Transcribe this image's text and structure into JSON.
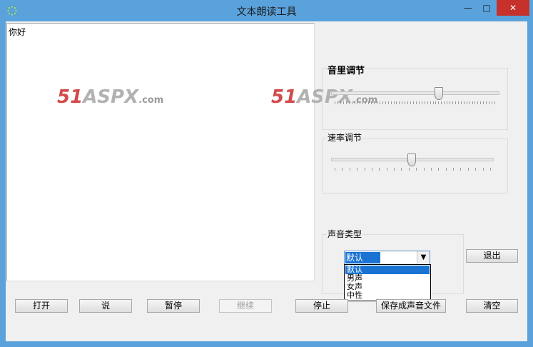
{
  "window": {
    "title": "文本朗读工具",
    "controls": {
      "minimize": "—",
      "maximize": "□",
      "close": "✕"
    }
  },
  "text_area": {
    "value": "你好"
  },
  "watermarks": [
    {
      "num": "51",
      "brand": "ASPX",
      "domain": ".com"
    },
    {
      "num": "51",
      "brand": "ASPX",
      "domain": ".com"
    }
  ],
  "volume": {
    "label": "音里调节",
    "level": 0.65
  },
  "rate": {
    "label": "速率调节",
    "level": 0.5
  },
  "voice": {
    "label": "声音类型",
    "selected": "默认",
    "options": [
      "默认",
      "男声",
      "女声",
      "中性"
    ]
  },
  "buttons": {
    "exit": "退出",
    "open": "打开",
    "speak": "说",
    "pause": "暂停",
    "resume": "继续",
    "stop": "停止",
    "save": "保存成声音文件",
    "clear": "清空"
  }
}
